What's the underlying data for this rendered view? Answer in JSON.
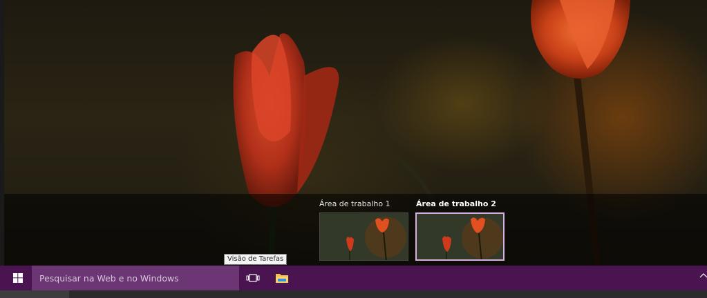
{
  "desktop_switcher": {
    "desktops": [
      {
        "label": "Área de trabalho 1",
        "active": false
      },
      {
        "label": "Área de trabalho 2",
        "active": true
      }
    ]
  },
  "taskbar": {
    "search_placeholder": "Pesquisar na Web e no Windows",
    "taskview_tooltip": "Visão de Tarefas",
    "color": "#4a1450",
    "search_color": "#6c3674",
    "icons": [
      "windows-logo-icon",
      "task-view-icon",
      "file-explorer-icon",
      "chevron-up-icon"
    ]
  }
}
